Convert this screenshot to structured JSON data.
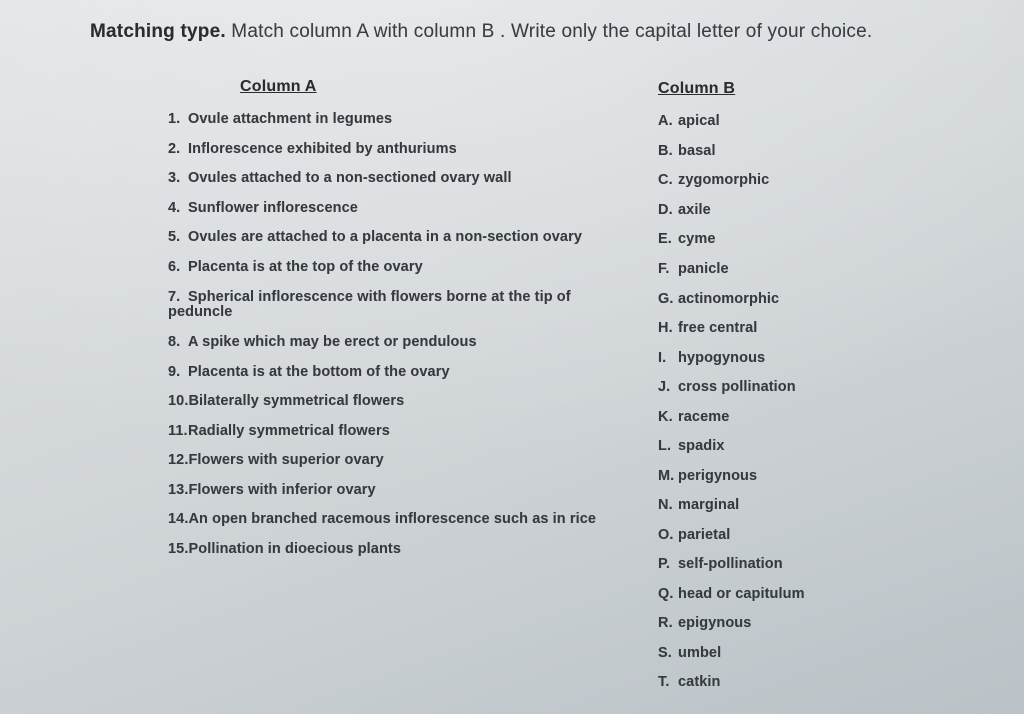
{
  "instructions": {
    "bold_lead": "Matching type.",
    "rest": " Match column A with column B . Write only the capital letter of your choice."
  },
  "columnA": {
    "header": "Column A",
    "items": [
      {
        "n": "1.",
        "text": "Ovule attachment in legumes"
      },
      {
        "n": "2.",
        "text": "Inflorescence exhibited by anthuriums"
      },
      {
        "n": "3.",
        "text": "Ovules attached to a  non-sectioned ovary wall"
      },
      {
        "n": "4.",
        "text": "Sunflower inflorescence"
      },
      {
        "n": "5.",
        "text": "Ovules are attached to a placenta in a non-section ovary"
      },
      {
        "n": "6.",
        "text": "Placenta is at the top of the ovary"
      },
      {
        "n": "7.",
        "text": "Spherical inflorescence with flowers borne at the tip of peduncle"
      },
      {
        "n": "8.",
        "text": "A spike which may be erect or pendulous"
      },
      {
        "n": "9.",
        "text": "Placenta is at the bottom of the ovary"
      },
      {
        "n": "10.",
        "text": "Bilaterally symmetrical flowers"
      },
      {
        "n": "11.",
        "text": "Radially symmetrical flowers"
      },
      {
        "n": "12.",
        "text": "Flowers with superior ovary"
      },
      {
        "n": "13.",
        "text": "Flowers with inferior ovary"
      },
      {
        "n": "14.",
        "text": "An open branched racemous inflorescence such as in rice"
      },
      {
        "n": "15.",
        "text": "Pollination in dioecious plants"
      }
    ]
  },
  "columnB": {
    "header": "Column B",
    "items": [
      {
        "l": "A.",
        "text": "apical"
      },
      {
        "l": "B.",
        "text": "basal"
      },
      {
        "l": "C.",
        "text": "zygomorphic"
      },
      {
        "l": "D.",
        "text": "axile"
      },
      {
        "l": "E.",
        "text": "cyme"
      },
      {
        "l": "F.",
        "text": "panicle"
      },
      {
        "l": "G.",
        "text": "actinomorphic"
      },
      {
        "l": "H.",
        "text": "free central"
      },
      {
        "l": "I.",
        "text": "hypogynous"
      },
      {
        "l": "J.",
        "text": "cross pollination"
      },
      {
        "l": "K.",
        "text": "raceme"
      },
      {
        "l": "L.",
        "text": "spadix"
      },
      {
        "l": "M.",
        "text": "perigynous"
      },
      {
        "l": "N.",
        "text": "marginal"
      },
      {
        "l": "O.",
        "text": "parietal"
      },
      {
        "l": "P.",
        "text": "self-pollination"
      },
      {
        "l": "Q.",
        "text": "head or capitulum"
      },
      {
        "l": "R.",
        "text": "epigynous"
      },
      {
        "l": "S.",
        "text": "umbel"
      },
      {
        "l": "T.",
        "text": "catkin"
      }
    ]
  }
}
